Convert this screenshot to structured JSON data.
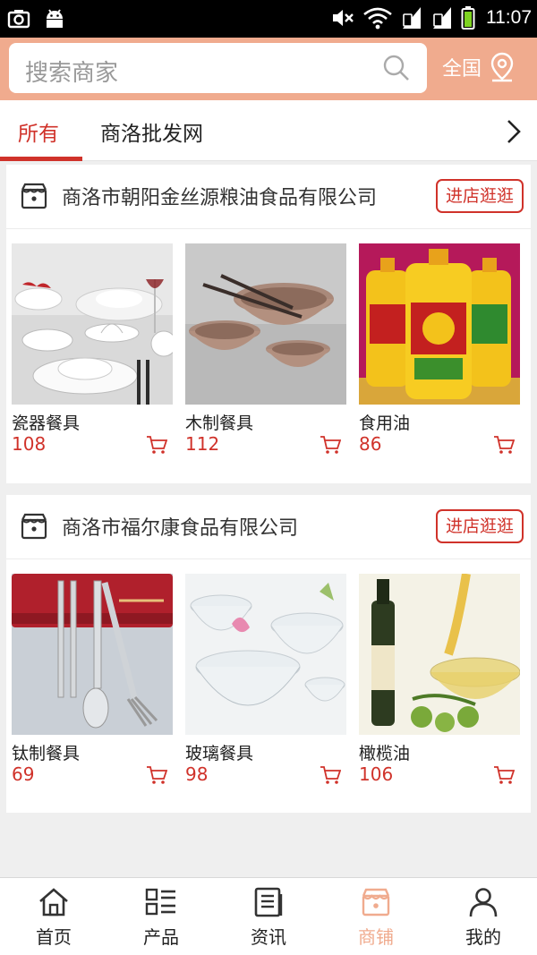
{
  "status_bar": {
    "time": "11:07"
  },
  "search": {
    "placeholder": "搜索商家",
    "region_label": "全国"
  },
  "tabs": [
    {
      "label": "所有",
      "active": true
    },
    {
      "label": "商洛批发网",
      "active": false
    }
  ],
  "shops": [
    {
      "name": "商洛市朝阳金丝源粮油食品有限公司",
      "enter_label": "进店逛逛",
      "products": [
        {
          "name": "瓷器餐具",
          "price": "108"
        },
        {
          "name": "木制餐具",
          "price": "112"
        },
        {
          "name": "食用油",
          "price": "86"
        }
      ]
    },
    {
      "name": "商洛市福尔康食品有限公司",
      "enter_label": "进店逛逛",
      "products": [
        {
          "name": "钛制餐具",
          "price": "69"
        },
        {
          "name": "玻璃餐具",
          "price": "98"
        },
        {
          "name": "橄榄油",
          "price": "106"
        }
      ]
    }
  ],
  "bottom_nav": [
    {
      "label": "首页",
      "icon": "home-icon",
      "active": false
    },
    {
      "label": "产品",
      "icon": "grid-list-icon",
      "active": false
    },
    {
      "label": "资讯",
      "icon": "news-icon",
      "active": false
    },
    {
      "label": "商铺",
      "icon": "shop-icon",
      "active": true
    },
    {
      "label": "我的",
      "icon": "user-icon",
      "active": false
    }
  ],
  "colors": {
    "accent": "#f0ab8e",
    "price_red": "#d0322a"
  }
}
